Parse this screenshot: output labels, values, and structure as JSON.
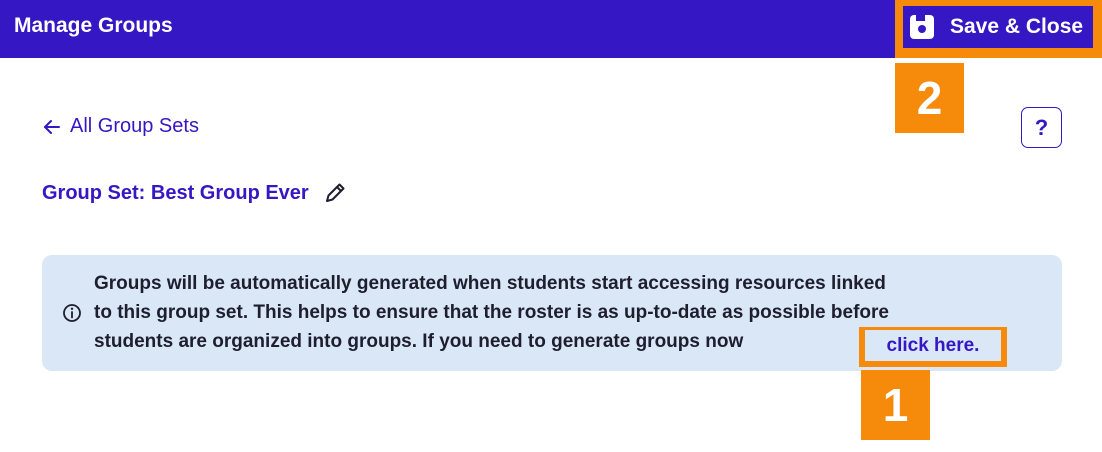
{
  "header": {
    "title": "Manage Groups",
    "save_label": "Save & Close",
    "save_icon": "floppy-disk-icon"
  },
  "callouts": {
    "save": "2",
    "click_here": "1"
  },
  "nav": {
    "back_label": "All Group Sets",
    "back_icon": "arrow-left-icon",
    "help_label": "?"
  },
  "group_set": {
    "title": "Group Set: Best Group Ever",
    "edit_icon": "pencil-icon"
  },
  "info": {
    "icon": "info-icon",
    "lines": [
      "Groups will be automatically generated when students start accessing resources linked",
      "to this group set. This helps to ensure that the roster is as up-to-date as possible before",
      "students are organized into groups. If you need to generate groups now"
    ],
    "link_label": "click here."
  },
  "colors": {
    "brand": "#3617c4",
    "highlight": "#f58a0b",
    "info_bg": "#d9e7f7"
  }
}
